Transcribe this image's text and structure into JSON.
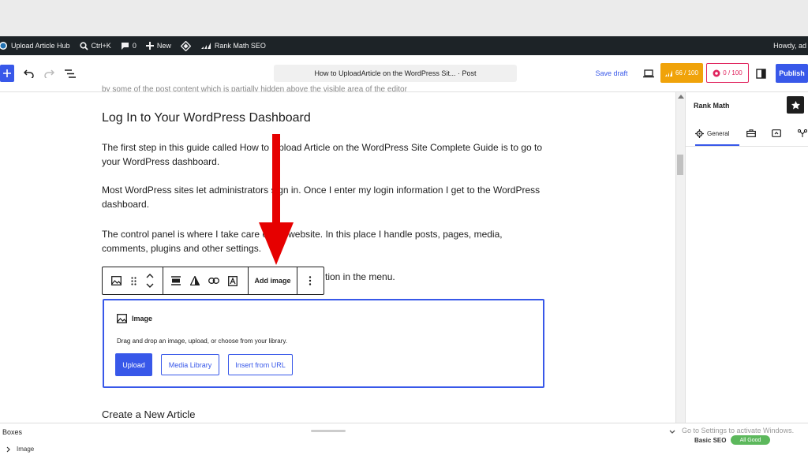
{
  "admin_bar": {
    "site_name": "Upload Article Hub",
    "search_shortcut": "Ctrl+K",
    "comments_count": "0",
    "new_label": "New",
    "rank_math_label": "Rank Math SEO",
    "howdy": "Howdy, ad"
  },
  "header": {
    "doc_title": "How to UploadArticle on the WordPress Sit... · Post",
    "save_draft": "Save draft",
    "seo_score": "66 / 100",
    "content_score": "0 / 100",
    "publish": "Publish"
  },
  "content": {
    "partial_top": "by some of the post content which is partially hidden above the visible area of the editor",
    "heading1": "Log In to Your WordPress Dashboard",
    "para1": "The first step in this guide called How to Upload Article on the WordPress Site Complete Guide is to go to your WordPress dashboard.",
    "para2": "Most WordPress sites let administrators sign in. Once I enter my login information I get to the WordPress dashboard.",
    "para3": "The control panel is where I take care of my website. In this place I handle posts, pages, media, comments, plugins and other settings.",
    "para4_tail": "tion in the menu.",
    "heading2": "Create a New Article"
  },
  "block_toolbar": {
    "add_image": "Add image"
  },
  "image_block": {
    "title": "Image",
    "instructions": "Drag and drop an image, upload, or choose from your library.",
    "upload": "Upload",
    "media_library": "Media Library",
    "insert_url": "Insert from URL"
  },
  "sidebar": {
    "title": "Rank Math",
    "tab_general": "General"
  },
  "bottom": {
    "boxes": "Boxes",
    "image": "Image",
    "windows_notice": "Go to Settings to activate Windows.",
    "basic_seo": "Basic SEO",
    "all_good": "All Good"
  },
  "colors": {
    "accent": "#3858e9",
    "admin_bar": "#1d2327",
    "arrow": "#e60000",
    "seo_badge": "#f0a30a",
    "content_badge": "#e0245e"
  },
  "icons": [
    "wordpress-icon",
    "search-icon",
    "comment-icon",
    "plus-icon",
    "diamond-icon",
    "rank-math-icon",
    "undo-icon",
    "redo-icon",
    "list-view-icon",
    "preview-icon",
    "settings-panel-icon",
    "star-icon",
    "gear-icon",
    "toolbox-icon",
    "social-icon",
    "schema-icon",
    "image-icon",
    "drag-icon",
    "move-icon",
    "align-icon",
    "duotone-icon",
    "link-icon",
    "alt-text-icon",
    "more-icon",
    "arrow-down-icon"
  ]
}
